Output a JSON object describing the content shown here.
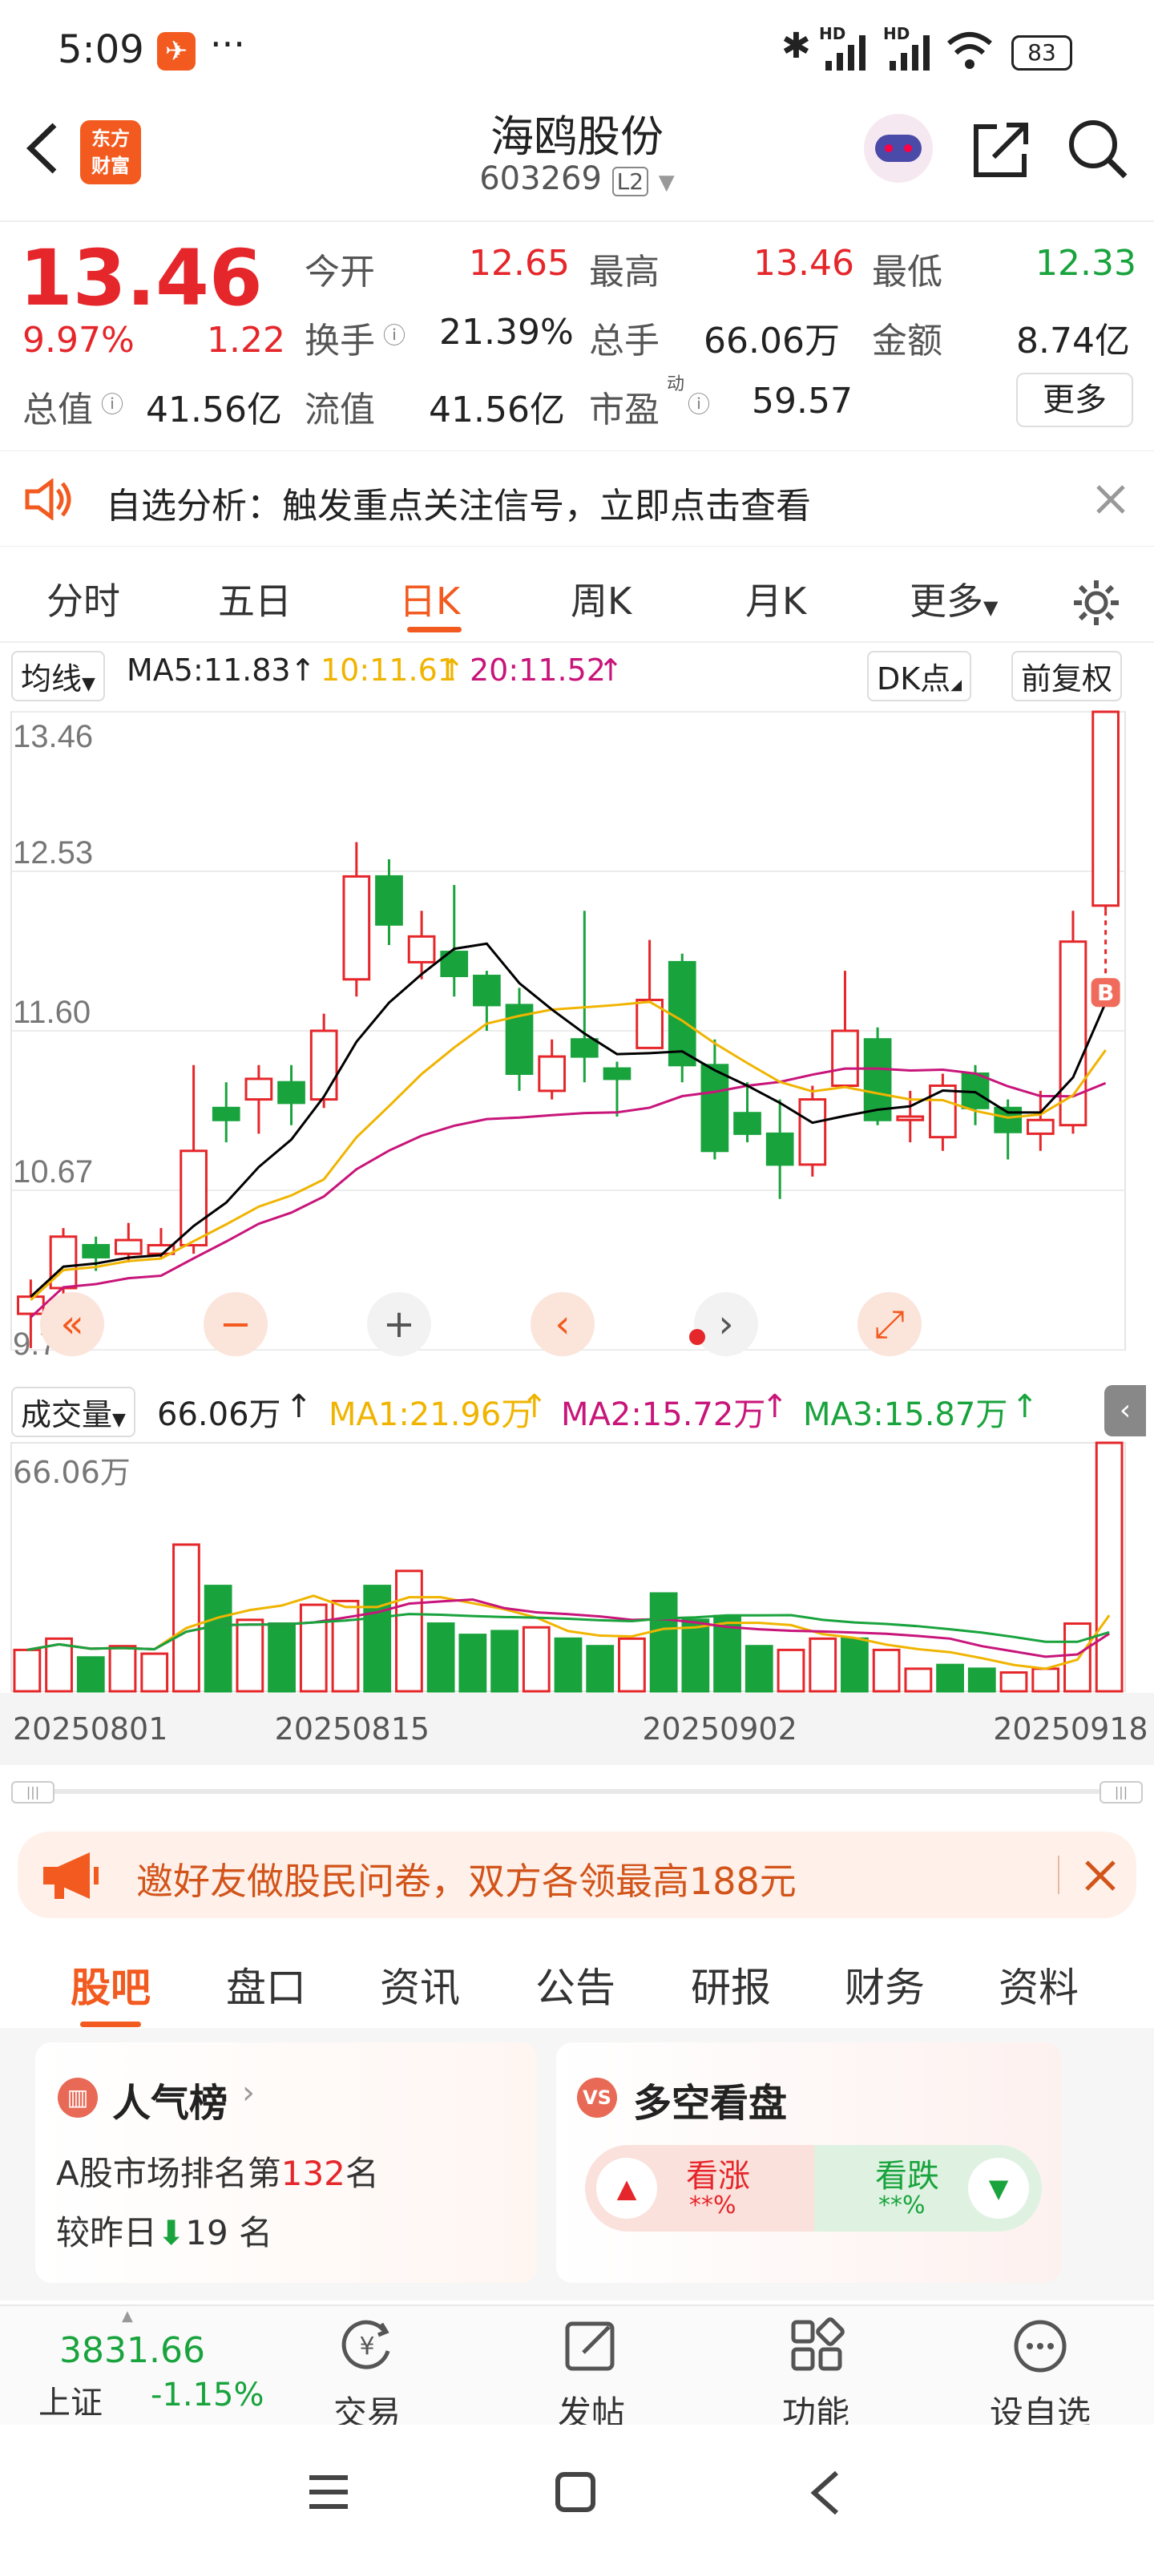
{
  "status": {
    "time": "5:09",
    "more": "···",
    "battery": "83",
    "signal1": "HD",
    "signal2": "HD"
  },
  "header": {
    "title": "海鸥股份",
    "code": "603269",
    "level": "L2",
    "logo_line1": "东方",
    "logo_line2": "财富"
  },
  "quote": {
    "price": "13.46",
    "pct": "9.97%",
    "chg": "1.22",
    "open_label": "今开",
    "open": "12.65",
    "high_label": "最高",
    "high": "13.46",
    "low_label": "最低",
    "low": "12.33",
    "turnover_label": "换手",
    "turnover": "21.39%",
    "volume_label": "总手",
    "volume": "66.06万",
    "amount_label": "金额",
    "amount": "8.74亿",
    "mcap_label": "总值",
    "mcap": "41.56亿",
    "float_label": "流值",
    "float": "41.56亿",
    "pe_label": "市盈",
    "pe_sup": "动",
    "pe": "59.57",
    "more_button": "更多"
  },
  "notice": {
    "text": "自选分析：触发重点关注信号，立即点击查看"
  },
  "tabs": {
    "items": [
      "分时",
      "五日",
      "日K",
      "周K",
      "月K",
      "更多"
    ],
    "active": 2
  },
  "ma_bar": {
    "type": "均线",
    "ma5": "MA5:11.83",
    "ma10": "10:11.61",
    "ma20": "20:11.52",
    "dk": "DK点",
    "adjust": "前复权"
  },
  "colors": {
    "up": "#e5262a",
    "down": "#19a33d",
    "ma5": "#000000",
    "ma10": "#f0b400",
    "ma20": "#c8157a",
    "vol_ma1": "#f0b400",
    "vol_ma2": "#c8157a",
    "vol_ma3": "#19a33d"
  },
  "kline_axis": {
    "labels": [
      "13.46",
      "12.53",
      "11.60",
      "10.67",
      "9.74"
    ]
  },
  "chart_data": {
    "type": "candlestick",
    "ylim": [
      9.74,
      13.46
    ],
    "y_ticks": [
      13.46,
      12.53,
      11.6,
      10.67,
      9.74
    ],
    "x_labels": [
      "20250801",
      "20250815",
      "20250902",
      "20250918"
    ],
    "candles": [
      [
        9.95,
        10.05,
        9.75,
        10.15
      ],
      [
        10.1,
        10.4,
        9.95,
        10.45
      ],
      [
        10.35,
        10.28,
        10.2,
        10.4
      ],
      [
        10.3,
        10.38,
        10.25,
        10.48
      ],
      [
        10.3,
        10.35,
        10.28,
        10.45
      ],
      [
        10.35,
        10.9,
        10.3,
        11.4
      ],
      [
        11.15,
        11.08,
        10.95,
        11.3
      ],
      [
        11.2,
        11.32,
        11.0,
        11.4
      ],
      [
        11.3,
        11.18,
        11.05,
        11.4
      ],
      [
        11.2,
        11.6,
        11.15,
        11.7
      ],
      [
        11.9,
        12.5,
        11.8,
        12.7
      ],
      [
        12.5,
        12.22,
        12.1,
        12.6
      ],
      [
        12.0,
        12.15,
        11.9,
        12.3
      ],
      [
        12.06,
        11.92,
        11.8,
        12.45
      ],
      [
        11.92,
        11.75,
        11.6,
        11.95
      ],
      [
        11.75,
        11.35,
        11.25,
        11.85
      ],
      [
        11.25,
        11.45,
        11.2,
        11.55
      ],
      [
        11.55,
        11.45,
        11.3,
        12.3
      ],
      [
        11.38,
        11.32,
        11.1,
        11.42
      ],
      [
        11.5,
        11.78,
        11.6,
        12.13
      ],
      [
        12.0,
        11.4,
        11.3,
        12.05
      ],
      [
        11.4,
        10.9,
        10.85,
        11.55
      ],
      [
        11.12,
        11.0,
        10.95,
        11.3
      ],
      [
        11.0,
        10.82,
        10.62,
        11.2
      ],
      [
        10.82,
        11.2,
        10.75,
        11.28
      ],
      [
        11.28,
        11.6,
        11.3,
        11.95
      ],
      [
        11.55,
        11.08,
        11.05,
        11.62
      ],
      [
        11.08,
        11.1,
        10.95,
        11.25
      ],
      [
        10.98,
        11.28,
        10.9,
        11.35
      ],
      [
        11.35,
        11.15,
        11.05,
        11.4
      ],
      [
        11.15,
        11.01,
        10.85,
        11.2
      ],
      [
        11.0,
        11.08,
        10.9,
        11.25
      ],
      [
        11.05,
        12.12,
        11.0,
        12.3
      ],
      [
        12.33,
        13.46,
        12.3,
        13.46
      ]
    ],
    "ma5_last": 11.83,
    "ma10_last": 11.61,
    "ma20_last": 11.52,
    "volume": {
      "last": "66.06万",
      "ma1": "MA1:21.96万",
      "ma2": "MA2:15.72万",
      "ma3": "MA3:15.87万",
      "ylabel": "66.06万",
      "bars": [
        11,
        14,
        9,
        12,
        10,
        39,
        28,
        19,
        18,
        23,
        24,
        28,
        32,
        18,
        15,
        16,
        17,
        14,
        12,
        14,
        26,
        19,
        20,
        12,
        11,
        14,
        14,
        11,
        6,
        7,
        6,
        5,
        6,
        18,
        66.06
      ]
    }
  },
  "volume_bar": {
    "type": "成交量",
    "value": "66.06万"
  },
  "promo": {
    "text": "邀好友做股民问卷，双方各领最高188元"
  },
  "subtabs": {
    "items": [
      "股吧",
      "盘口",
      "资讯",
      "公告",
      "研报",
      "财务",
      "资料"
    ],
    "active": 0
  },
  "cards": {
    "popular": {
      "title": "人气榜",
      "rank_prefix": "A股市场排名第",
      "rank": "132",
      "rank_suffix": "名",
      "change_prefix": "较昨日",
      "change": "19",
      "change_suffix": "名"
    },
    "bull_bear": {
      "title": "多空看盘",
      "up_label": "看涨",
      "up_value": "**%",
      "down_label": "看跌",
      "down_value": "**%"
    }
  },
  "bottom_nav": {
    "index_value": "3831.66",
    "index_name": "上证",
    "index_change": "-1.15%",
    "items": [
      "交易",
      "发帖",
      "功能",
      "设自选"
    ]
  }
}
